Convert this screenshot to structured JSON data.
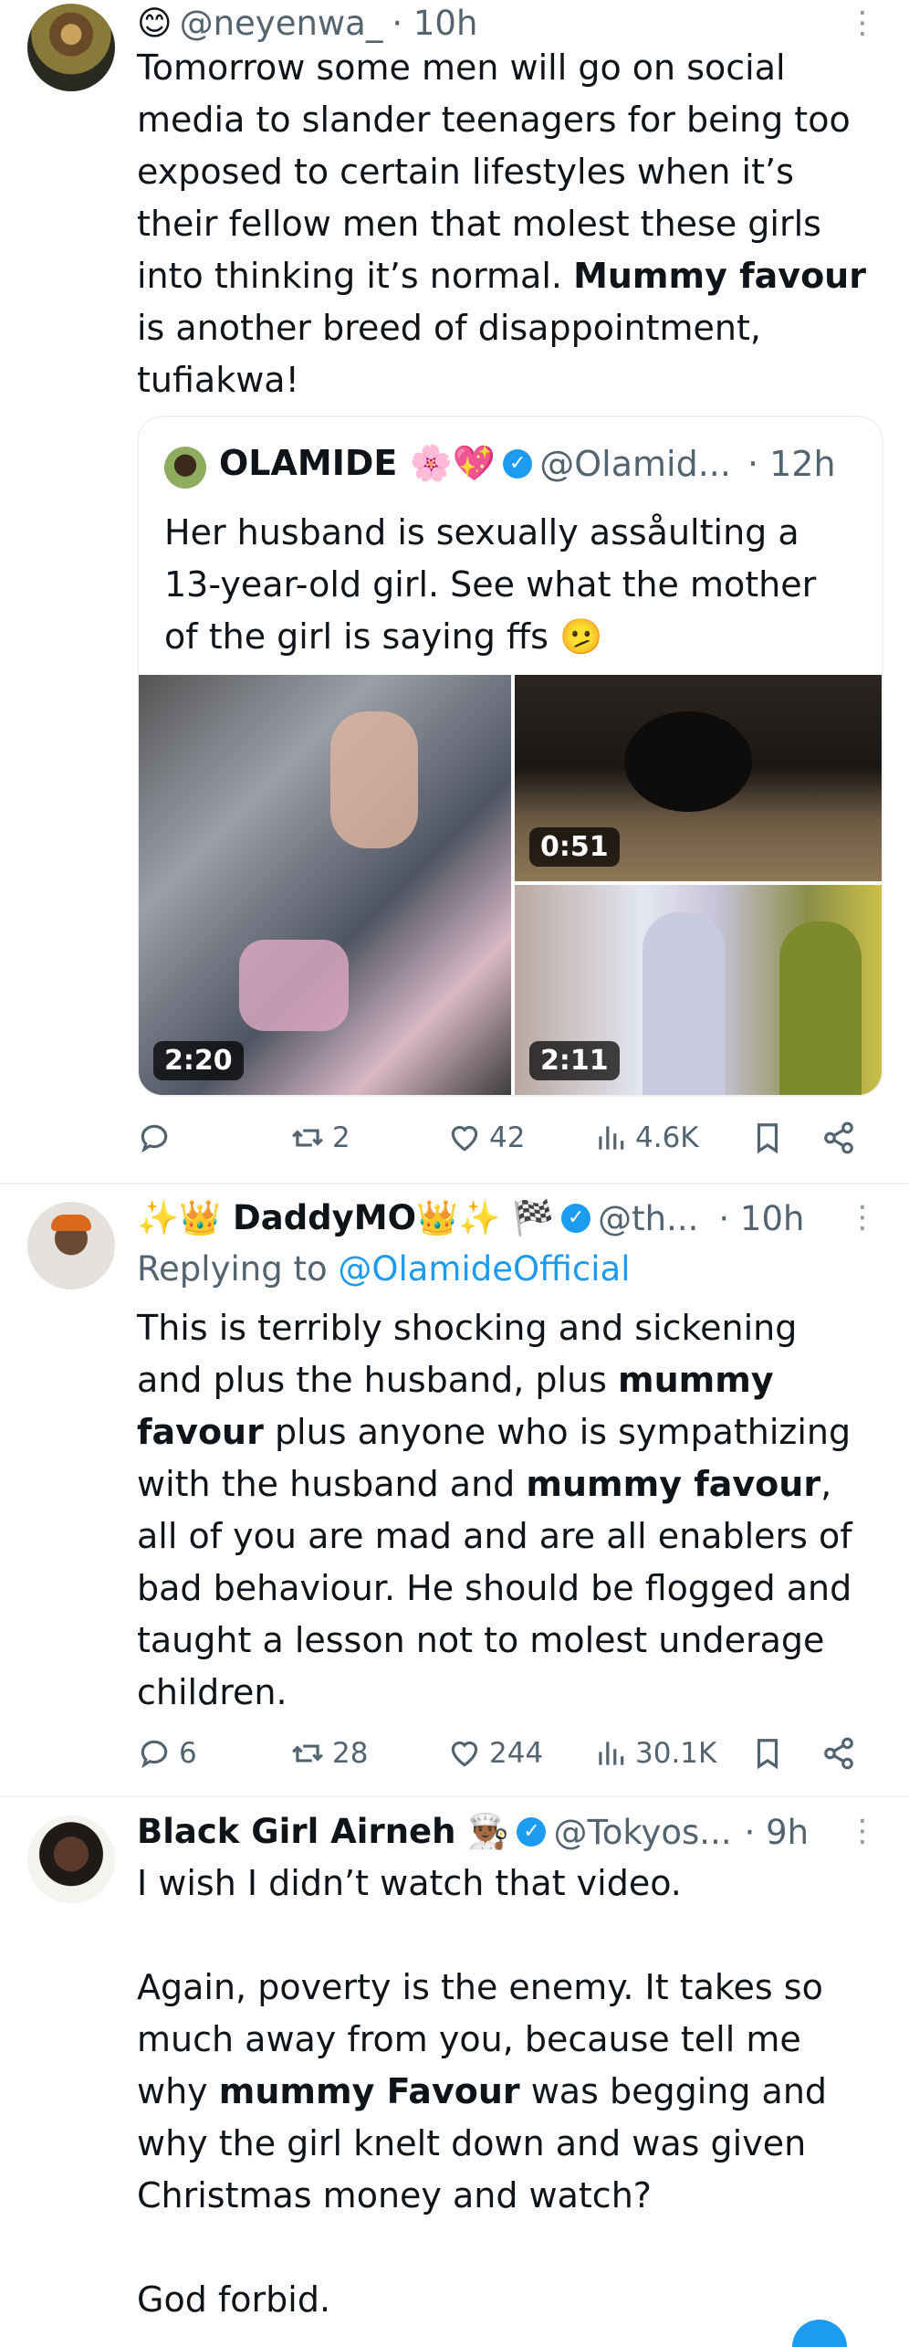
{
  "tweets": [
    {
      "name_emoji": "😊",
      "handle": "@neyenwa_",
      "time": "· 10h",
      "text_parts": [
        "Tomorrow some men will go on social media to slander teenagers for being too exposed to certain lifestyles when it’s their fellow men that molest these girls into thinking it’s normal. ",
        "Mummy favour",
        " is another breed of disappointment, tufiakwa!"
      ],
      "quote": {
        "name": "OLAMIDE 🌸💖",
        "handle": "@Olamid...",
        "time": "· 12h",
        "text": "Her husband is sexually assåulting a 13-year-old girl. See what the mother of the girl is saying ffs 🫤",
        "durations": [
          "2:20",
          "0:51",
          "2:11"
        ]
      },
      "stats": {
        "replies": "",
        "reposts": "2",
        "likes": "42",
        "views": "4.6K"
      }
    },
    {
      "name": "✨👑 DaddyMO👑✨ 🏁",
      "handle": "@th...",
      "time": "· 10h",
      "replying_prefix": "Replying to ",
      "replying_to": "@OlamideOfficial",
      "text_parts": [
        "This is terribly shocking and sickening and plus the husband, plus ",
        "mummy favour",
        " plus anyone who is sympathizing with the husband and ",
        "mummy favour",
        ", all of you are mad and are all enablers of bad behaviour. He should be flogged and taught a lesson not to molest underage children."
      ],
      "stats": {
        "replies": "6",
        "reposts": "28",
        "likes": "244",
        "views": "30.1K"
      }
    },
    {
      "name": "Black Girl Airneh 👨🏾‍🍳",
      "handle": "@Tokyos...",
      "time": "· 9h",
      "text_parts": [
        "I wish I didn’t watch that video.\n\nAgain, poverty is the enemy. It takes so much away from you, because tell me why ",
        "mummy Favour",
        " was begging and why the girl knelt down and was given Christmas money and watch?\n\nGod forbid."
      ]
    }
  ]
}
